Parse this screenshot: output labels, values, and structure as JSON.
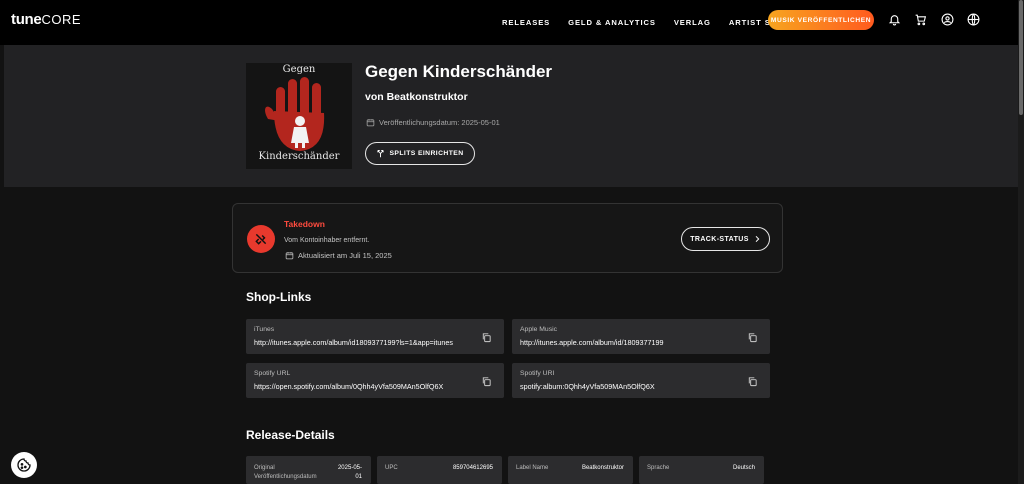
{
  "header": {
    "logo_main": "tune",
    "logo_core": "CORE",
    "nav": [
      "RELEASES",
      "GELD & ANALYTICS",
      "VERLAG",
      "ARTIST SERVICES"
    ],
    "cta": "MUSIK VERÖFFENTLICHEN",
    "icons": [
      "bell-icon",
      "cart-icon",
      "account-icon",
      "globe-icon"
    ]
  },
  "release": {
    "cover_top_text": "Gegen",
    "cover_bottom_text": "Kinderschänder",
    "title": "Gegen Kinderschänder",
    "artist": "von Beatkonstruktor",
    "release_date": "Veröffentlichungsdatum: 2025-05-01",
    "splits_button": "SPLITS EINRICHTEN"
  },
  "status": {
    "label": "Takedown",
    "message": "Vom Kontoinhaber entfernt.",
    "updated": "Aktualisiert am Juli 15, 2025",
    "track_button": "TRACK-STATUS",
    "color": "#e8392d"
  },
  "shop_links": {
    "heading": "Shop-Links",
    "items": [
      {
        "label": "iTunes",
        "value": "http://itunes.apple.com/album/id1809377199?ls=1&app=itunes"
      },
      {
        "label": "Apple Music",
        "value": "http://itunes.apple.com/album/id/1809377199"
      },
      {
        "label": "Spotify URL",
        "value": "https://open.spotify.com/album/0Qhh4yVfa509MAn5OlfQ6X"
      },
      {
        "label": "Spotify URI",
        "value": "spotify:album:0Qhh4yVfa509MAn5OlfQ6X"
      }
    ]
  },
  "release_details": {
    "heading": "Release-Details",
    "items": [
      {
        "label_1": "Original",
        "label_2": "Veröffentlichungsdatum",
        "value_1": "2025-05-",
        "value_2": "01"
      },
      {
        "label_1": "UPC",
        "label_2": "",
        "value_1": "859704612695",
        "value_2": ""
      },
      {
        "label_1": "Label Name",
        "label_2": "",
        "value_1": "Beatkonstruktor",
        "value_2": ""
      },
      {
        "label_1": "Sprache",
        "label_2": "",
        "value_1": "Deutsch",
        "value_2": ""
      }
    ]
  },
  "colors": {
    "accent_gradient_start": "#f7a51f",
    "accent_gradient_end": "#ff5a1f",
    "background": "#121212",
    "hero": "#222224",
    "card": "#2c2c2e"
  }
}
